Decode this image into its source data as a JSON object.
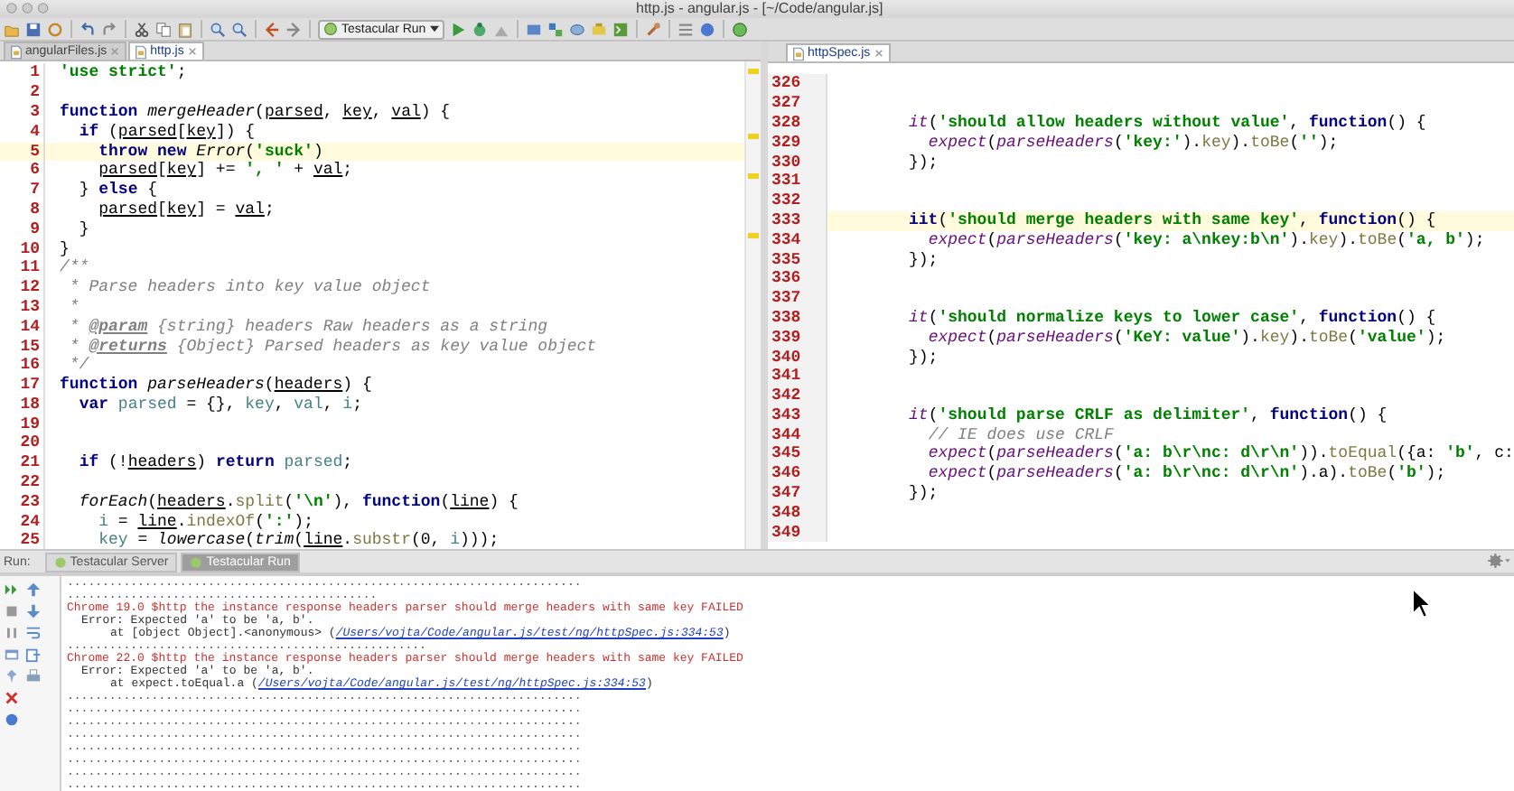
{
  "window": {
    "title": "http.js - angular.js - [~/Code/angular.js]"
  },
  "toolbar": {
    "run_config": "Testacular Run"
  },
  "editors": [
    {
      "tabs": [
        {
          "label": "angularFiles.js",
          "selected": false
        },
        {
          "label": "http.js",
          "selected": true
        }
      ],
      "lines": [
        {
          "number": "1",
          "current": false,
          "tokens": [
            {
              "kind": "str",
              "text": "'use strict'"
            },
            {
              "kind": "p",
              "text": ";"
            }
          ]
        },
        {
          "number": "2",
          "current": false
        },
        {
          "number": "3",
          "current": false,
          "tokens": [
            {
              "kind": "kw",
              "text": "function "
            },
            {
              "kind": "fn",
              "text": "mergeHeader"
            },
            {
              "kind": "p",
              "text": "("
            },
            {
              "kind": "arg",
              "text": "parsed"
            },
            {
              "kind": "p",
              "text": ", "
            },
            {
              "kind": "arg",
              "text": "key"
            },
            {
              "kind": "p",
              "text": ", "
            },
            {
              "kind": "arg",
              "text": "val"
            },
            {
              "kind": "p",
              "text": ") {"
            }
          ]
        },
        {
          "number": "4",
          "current": false,
          "tokens": [
            {
              "kind": "kw",
              "text": "  if "
            },
            {
              "kind": "p",
              "text": "("
            },
            {
              "kind": "arg",
              "text": "parsed"
            },
            {
              "kind": "p",
              "text": "["
            },
            {
              "kind": "arg",
              "text": "key"
            },
            {
              "kind": "p",
              "text": "]) {"
            }
          ]
        },
        {
          "number": "5",
          "current": true,
          "tokens": [
            {
              "kind": "kw",
              "text": "    throw new "
            },
            {
              "kind": "fn",
              "text": "Error"
            },
            {
              "kind": "p",
              "text": "("
            },
            {
              "kind": "str",
              "text": "'suck'"
            },
            {
              "kind": "p",
              "text": ")"
            }
          ]
        },
        {
          "number": "6",
          "current": false,
          "tokens": [
            {
              "kind": "arg",
              "text": "    parsed"
            },
            {
              "kind": "p",
              "text": "["
            },
            {
              "kind": "arg",
              "text": "key"
            },
            {
              "kind": "p",
              "text": "] += "
            },
            {
              "kind": "str",
              "text": "', '"
            },
            {
              "kind": "p",
              "text": " + "
            },
            {
              "kind": "arg",
              "text": "val"
            },
            {
              "kind": "p",
              "text": ";"
            }
          ]
        },
        {
          "number": "7",
          "current": false,
          "tokens": [
            {
              "kind": "p",
              "text": "  } "
            },
            {
              "kind": "kw",
              "text": "else"
            },
            {
              "kind": "p",
              "text": " {"
            }
          ]
        },
        {
          "number": "8",
          "current": false,
          "tokens": [
            {
              "kind": "arg",
              "text": "    parsed"
            },
            {
              "kind": "p",
              "text": "["
            },
            {
              "kind": "arg",
              "text": "key"
            },
            {
              "kind": "p",
              "text": "] = "
            },
            {
              "kind": "arg",
              "text": "val"
            },
            {
              "kind": "p",
              "text": ";"
            }
          ]
        },
        {
          "number": "9",
          "current": false,
          "tokens": [
            {
              "kind": "p",
              "text": "  }"
            }
          ]
        },
        {
          "number": "10",
          "current": false,
          "tokens": [
            {
              "kind": "p",
              "text": "}"
            }
          ]
        },
        {
          "number": "11",
          "current": false,
          "tokens": [
            {
              "kind": "cm",
              "text": "/**"
            }
          ]
        },
        {
          "number": "12",
          "current": false,
          "tokens": [
            {
              "kind": "cm",
              "text": " * Parse headers into key value object"
            }
          ]
        },
        {
          "number": "13",
          "current": false,
          "tokens": [
            {
              "kind": "cm",
              "text": " *"
            }
          ]
        },
        {
          "number": "14",
          "current": false,
          "tokens": [
            {
              "kind": "cm",
              "text": " * "
            },
            {
              "kind": "tag",
              "text": "@param"
            },
            {
              "kind": "cm",
              "text": " {string} headers Raw headers as a string"
            }
          ]
        },
        {
          "number": "15",
          "current": false,
          "tokens": [
            {
              "kind": "cm",
              "text": " * "
            },
            {
              "kind": "tag",
              "text": "@returns"
            },
            {
              "kind": "cm",
              "text": " {Object} Parsed headers as key value object"
            }
          ]
        },
        {
          "number": "16",
          "current": false,
          "tokens": [
            {
              "kind": "cm",
              "text": " */"
            }
          ]
        },
        {
          "number": "17",
          "current": false,
          "tokens": [
            {
              "kind": "kw",
              "text": "function "
            },
            {
              "kind": "fn",
              "text": "parseHeaders"
            },
            {
              "kind": "p",
              "text": "("
            },
            {
              "kind": "arg",
              "text": "headers"
            },
            {
              "kind": "p",
              "text": ") {"
            }
          ]
        },
        {
          "number": "18",
          "current": false,
          "tokens": [
            {
              "kind": "kw",
              "text": "  var "
            },
            {
              "kind": "var",
              "text": "parsed"
            },
            {
              "kind": "p",
              "text": " = {}, "
            },
            {
              "kind": "var",
              "text": "key"
            },
            {
              "kind": "p",
              "text": ", "
            },
            {
              "kind": "var",
              "text": "val"
            },
            {
              "kind": "p",
              "text": ", "
            },
            {
              "kind": "var",
              "text": "i"
            },
            {
              "kind": "p",
              "text": ";"
            }
          ]
        },
        {
          "number": "19",
          "current": false
        },
        {
          "number": "20",
          "current": false
        },
        {
          "number": "21",
          "current": false,
          "tokens": [
            {
              "kind": "kw",
              "text": "  if "
            },
            {
              "kind": "p",
              "text": "(!"
            },
            {
              "kind": "arg",
              "text": "headers"
            },
            {
              "kind": "p",
              "text": ") "
            },
            {
              "kind": "kw",
              "text": "return "
            },
            {
              "kind": "var",
              "text": "parsed"
            },
            {
              "kind": "p",
              "text": ";"
            }
          ]
        },
        {
          "number": "22",
          "current": false
        },
        {
          "number": "23",
          "current": false,
          "tokens": [
            {
              "kind": "fn",
              "text": "  forEach"
            },
            {
              "kind": "p",
              "text": "("
            },
            {
              "kind": "arg",
              "text": "headers"
            },
            {
              "kind": "p",
              "text": "."
            },
            {
              "kind": "prop",
              "text": "split"
            },
            {
              "kind": "p",
              "text": "("
            },
            {
              "kind": "str",
              "text": "'\\n'"
            },
            {
              "kind": "p",
              "text": "), "
            },
            {
              "kind": "kw",
              "text": "function"
            },
            {
              "kind": "p",
              "text": "("
            },
            {
              "kind": "arg",
              "text": "line"
            },
            {
              "kind": "p",
              "text": ") {"
            }
          ]
        },
        {
          "number": "24",
          "current": false,
          "tokens": [
            {
              "kind": "var",
              "text": "    i"
            },
            {
              "kind": "p",
              "text": " = "
            },
            {
              "kind": "arg",
              "text": "line"
            },
            {
              "kind": "p",
              "text": "."
            },
            {
              "kind": "prop",
              "text": "indexOf"
            },
            {
              "kind": "p",
              "text": "("
            },
            {
              "kind": "str",
              "text": "':'"
            },
            {
              "kind": "p",
              "text": ");"
            }
          ]
        },
        {
          "number": "25",
          "current": false,
          "tokens": [
            {
              "kind": "var",
              "text": "    key"
            },
            {
              "kind": "p",
              "text": " = "
            },
            {
              "kind": "fn",
              "text": "lowercase"
            },
            {
              "kind": "p",
              "text": "("
            },
            {
              "kind": "fn",
              "text": "trim"
            },
            {
              "kind": "p",
              "text": "("
            },
            {
              "kind": "arg",
              "text": "line"
            },
            {
              "kind": "p",
              "text": "."
            },
            {
              "kind": "prop",
              "text": "substr"
            },
            {
              "kind": "p",
              "text": "(0, "
            },
            {
              "kind": "var",
              "text": "i"
            },
            {
              "kind": "p",
              "text": ")));"
            }
          ]
        }
      ]
    },
    {
      "tabs": [
        {
          "label": "httpSpec.js",
          "selected": true
        }
      ],
      "lines": [
        {
          "number": "326",
          "current": false
        },
        {
          "number": "327",
          "current": false
        },
        {
          "number": "328",
          "current": false,
          "tokens": [
            {
              "kind": "call",
              "text": "it"
            },
            {
              "kind": "p",
              "text": "("
            },
            {
              "kind": "str",
              "text": "'should allow headers without value'"
            },
            {
              "kind": "p",
              "text": ", "
            },
            {
              "kind": "kw",
              "text": "function"
            },
            {
              "kind": "p",
              "text": "() {"
            }
          ]
        },
        {
          "number": "329",
          "current": false,
          "tokens": [
            {
              "kind": "call",
              "text": "  expect"
            },
            {
              "kind": "p",
              "text": "("
            },
            {
              "kind": "call",
              "text": "parseHeaders"
            },
            {
              "kind": "p",
              "text": "("
            },
            {
              "kind": "str",
              "text": "'key:'"
            },
            {
              "kind": "p",
              "text": ")."
            },
            {
              "kind": "prop",
              "text": "key"
            },
            {
              "kind": "p",
              "text": ")."
            },
            {
              "kind": "prop",
              "text": "toBe"
            },
            {
              "kind": "p",
              "text": "("
            },
            {
              "kind": "str",
              "text": "''"
            },
            {
              "kind": "p",
              "text": ");"
            }
          ]
        },
        {
          "number": "330",
          "current": false,
          "tokens": [
            {
              "kind": "p",
              "text": "});"
            }
          ]
        },
        {
          "number": "331",
          "current": false
        },
        {
          "number": "332",
          "current": false
        },
        {
          "number": "333",
          "current": true,
          "tokens": [
            {
              "kind": "kw",
              "text": "iit"
            },
            {
              "kind": "p",
              "text": "("
            },
            {
              "kind": "str",
              "text": "'should merge headers with same key'"
            },
            {
              "kind": "p",
              "text": ", "
            },
            {
              "kind": "kw",
              "text": "function"
            },
            {
              "kind": "p",
              "text": "() {"
            }
          ]
        },
        {
          "number": "334",
          "current": false,
          "tokens": [
            {
              "kind": "call",
              "text": "  expect"
            },
            {
              "kind": "p",
              "text": "("
            },
            {
              "kind": "call",
              "text": "parseHeaders"
            },
            {
              "kind": "p",
              "text": "("
            },
            {
              "kind": "str",
              "text": "'key: a\\nkey:b\\n'"
            },
            {
              "kind": "p",
              "text": ")."
            },
            {
              "kind": "prop",
              "text": "key"
            },
            {
              "kind": "p",
              "text": ")."
            },
            {
              "kind": "prop",
              "text": "toBe"
            },
            {
              "kind": "p",
              "text": "("
            },
            {
              "kind": "str",
              "text": "'a, b'"
            },
            {
              "kind": "p",
              "text": ");"
            }
          ]
        },
        {
          "number": "335",
          "current": false,
          "tokens": [
            {
              "kind": "p",
              "text": "});"
            }
          ]
        },
        {
          "number": "336",
          "current": false
        },
        {
          "number": "337",
          "current": false
        },
        {
          "number": "338",
          "current": false,
          "tokens": [
            {
              "kind": "call",
              "text": "it"
            },
            {
              "kind": "p",
              "text": "("
            },
            {
              "kind": "str",
              "text": "'should normalize keys to lower case'"
            },
            {
              "kind": "p",
              "text": ", "
            },
            {
              "kind": "kw",
              "text": "function"
            },
            {
              "kind": "p",
              "text": "() {"
            }
          ]
        },
        {
          "number": "339",
          "current": false,
          "tokens": [
            {
              "kind": "call",
              "text": "  expect"
            },
            {
              "kind": "p",
              "text": "("
            },
            {
              "kind": "call",
              "text": "parseHeaders"
            },
            {
              "kind": "p",
              "text": "("
            },
            {
              "kind": "str",
              "text": "'KeY: value'"
            },
            {
              "kind": "p",
              "text": ")."
            },
            {
              "kind": "prop",
              "text": "key"
            },
            {
              "kind": "p",
              "text": ")."
            },
            {
              "kind": "prop",
              "text": "toBe"
            },
            {
              "kind": "p",
              "text": "("
            },
            {
              "kind": "str",
              "text": "'value'"
            },
            {
              "kind": "p",
              "text": ");"
            }
          ]
        },
        {
          "number": "340",
          "current": false,
          "tokens": [
            {
              "kind": "p",
              "text": "});"
            }
          ]
        },
        {
          "number": "341",
          "current": false
        },
        {
          "number": "342",
          "current": false
        },
        {
          "number": "343",
          "current": false,
          "tokens": [
            {
              "kind": "call",
              "text": "it"
            },
            {
              "kind": "p",
              "text": "("
            },
            {
              "kind": "str",
              "text": "'should parse CRLF as delimiter'"
            },
            {
              "kind": "p",
              "text": ", "
            },
            {
              "kind": "kw",
              "text": "function"
            },
            {
              "kind": "p",
              "text": "() {"
            }
          ]
        },
        {
          "number": "344",
          "current": false,
          "tokens": [
            {
              "kind": "cm",
              "text": "  // IE does use CRLF"
            }
          ]
        },
        {
          "number": "345",
          "current": false,
          "tokens": [
            {
              "kind": "call",
              "text": "  expect"
            },
            {
              "kind": "p",
              "text": "("
            },
            {
              "kind": "call",
              "text": "parseHeaders"
            },
            {
              "kind": "p",
              "text": "("
            },
            {
              "kind": "str",
              "text": "'a: b\\r\\nc: d\\r\\n'"
            },
            {
              "kind": "p",
              "text": "))."
            },
            {
              "kind": "prop",
              "text": "toEqual"
            },
            {
              "kind": "p",
              "text": "({a: "
            },
            {
              "kind": "str",
              "text": "'b'"
            },
            {
              "kind": "p",
              "text": ", c:"
            }
          ]
        },
        {
          "number": "346",
          "current": false,
          "tokens": [
            {
              "kind": "call",
              "text": "  expect"
            },
            {
              "kind": "p",
              "text": "("
            },
            {
              "kind": "call",
              "text": "parseHeaders"
            },
            {
              "kind": "p",
              "text": "("
            },
            {
              "kind": "str",
              "text": "'a: b\\r\\nc: d\\r\\n'"
            },
            {
              "kind": "p",
              "text": ").a)."
            },
            {
              "kind": "prop",
              "text": "toBe"
            },
            {
              "kind": "p",
              "text": "("
            },
            {
              "kind": "str",
              "text": "'b'"
            },
            {
              "kind": "p",
              "text": ");"
            }
          ]
        },
        {
          "number": "347",
          "current": false,
          "tokens": [
            {
              "kind": "p",
              "text": "});"
            }
          ]
        },
        {
          "number": "348",
          "current": false
        },
        {
          "number": "349",
          "current": false
        }
      ]
    }
  ],
  "run_panel": {
    "label": "Run:",
    "tabs": [
      {
        "label": "Testacular Server",
        "selected": false
      },
      {
        "label": "Testacular Run",
        "selected": true
      }
    ],
    "console": [
      {
        "kind": "dots",
        "text": "........................................................................."
      },
      {
        "kind": "dots",
        "text": "............................................"
      },
      {
        "kind": "fail",
        "text": "Chrome 19.0 $http the instance response headers parser should merge headers with same key FAILED"
      },
      {
        "kind": "error",
        "text": "Error: Expected 'a' to be 'a, b'."
      },
      {
        "kind": "trace",
        "text": "at [object Object].<anonymous> (",
        "link": "/Users/vojta/Code/angular.js/test/ng/httpSpec.js:334:53",
        "tail": ")"
      },
      {
        "kind": "dots",
        "text": "..................................................."
      },
      {
        "kind": "fail",
        "text": "Chrome 22.0 $http the instance response headers parser should merge headers with same key FAILED"
      },
      {
        "kind": "error",
        "text": "Error: Expected 'a' to be 'a, b'."
      },
      {
        "kind": "trace",
        "text": "at expect.toEqual.a (",
        "link": "/Users/vojta/Code/angular.js/test/ng/httpSpec.js:334:53",
        "tail": ")"
      },
      {
        "kind": "dots",
        "text": "........................................................................."
      },
      {
        "kind": "dots",
        "text": "........................................................................."
      },
      {
        "kind": "dots",
        "text": "........................................................................."
      },
      {
        "kind": "dots",
        "text": "........................................................................."
      },
      {
        "kind": "dots",
        "text": "........................................................................."
      },
      {
        "kind": "dots",
        "text": "........................................................................."
      },
      {
        "kind": "dots",
        "text": "........................................................................."
      },
      {
        "kind": "dots",
        "text": "........................................................................."
      }
    ]
  }
}
